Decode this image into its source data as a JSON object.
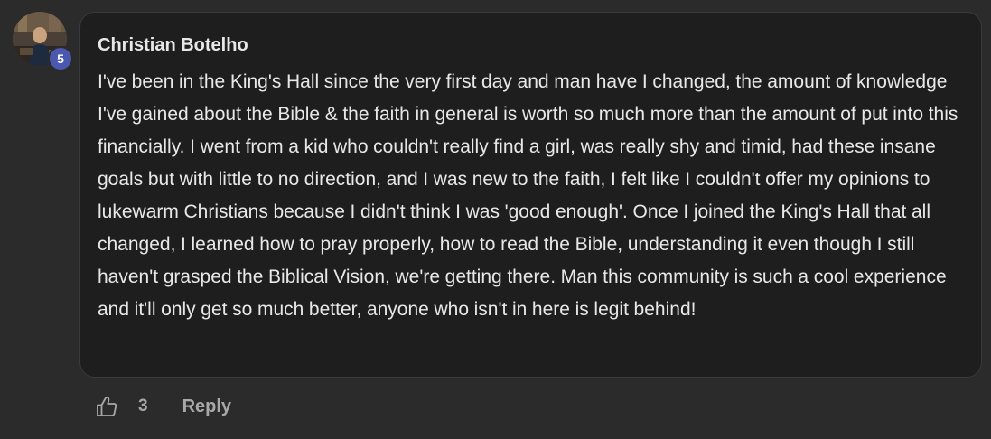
{
  "comment": {
    "author_name": "Christian Botelho",
    "level_badge": "5",
    "body": "I've been in the King's Hall since the very first day and man have I changed, the amount of knowledge I've gained about the Bible & the faith in general is worth so much more than the amount of put into this financially. I went from a kid who couldn't really find a girl, was really shy and timid, had these insane goals but with little to no direction, and I was new to the faith, I felt like I couldn't offer my opinions to lukewarm Christians because I didn't think I was 'good enough'. Once I joined the King's Hall that all changed, I learned how to pray properly, how to read the Bible, understanding it even though I still haven't grasped the Biblical Vision, we're getting there. Man this community is such a cool experience and it'll only get so much better, anyone who isn't in here is legit behind!",
    "like_count": "3",
    "reply_label": "Reply",
    "like_icon": "thumbs-up-icon"
  },
  "colors": {
    "page_background": "#2b2b2b",
    "bubble_background": "#1e1e1e",
    "text_primary": "#e8e8e8",
    "text_secondary": "#a8a8a8",
    "badge_background": "#4a58b0"
  }
}
